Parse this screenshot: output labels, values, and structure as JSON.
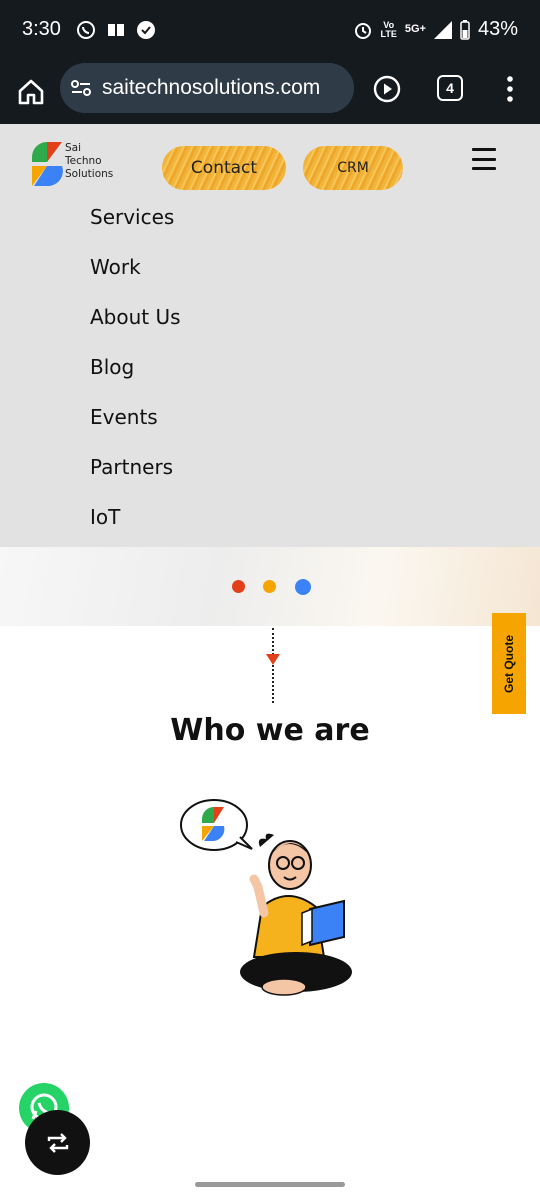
{
  "status_bar": {
    "time": "3:30",
    "network_top": "Vo",
    "network_bottom": "LTE",
    "network_5g": "5G+",
    "battery": "43%"
  },
  "browser": {
    "url": "saitechnosolutions.com",
    "tab_count": "4"
  },
  "site": {
    "logo_text": [
      "Sai",
      "Techno",
      "Solutions"
    ],
    "contact_label": "Contact",
    "crm_label": "CRM",
    "menu_items": [
      "Services",
      "Work",
      "About Us",
      "Blog",
      "Events",
      "Partners",
      "IoT"
    ],
    "get_quote_label": "Get Quote",
    "section_title": "Who we are"
  },
  "colors": {
    "accent_orange": "#f6a500",
    "logo_red": "#e2401b",
    "logo_green": "#2eaa4a",
    "logo_blue": "#3b82f6",
    "logo_yellow": "#f6a500",
    "whatsapp_green": "#25d366"
  },
  "carousel": {
    "dot_colors": [
      "#e2401b",
      "#f6a500",
      "#3b82f6"
    ],
    "active_index": 2
  }
}
